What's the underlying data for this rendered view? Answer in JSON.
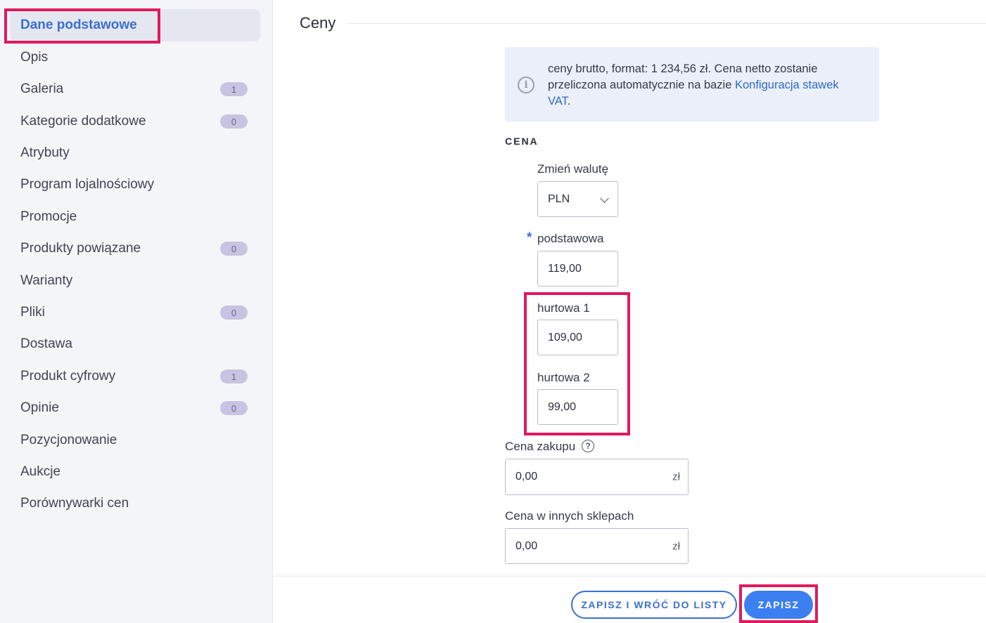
{
  "sidebar": {
    "items": [
      {
        "label": "Dane podstawowe",
        "badge": null
      },
      {
        "label": "Opis",
        "badge": null
      },
      {
        "label": "Galeria",
        "badge": "1"
      },
      {
        "label": "Kategorie dodatkowe",
        "badge": "0"
      },
      {
        "label": "Atrybuty",
        "badge": null
      },
      {
        "label": "Program lojalnościowy",
        "badge": null
      },
      {
        "label": "Promocje",
        "badge": null
      },
      {
        "label": "Produkty powiązane",
        "badge": "0"
      },
      {
        "label": "Warianty",
        "badge": null
      },
      {
        "label": "Pliki",
        "badge": "0"
      },
      {
        "label": "Dostawa",
        "badge": null
      },
      {
        "label": "Produkt cyfrowy",
        "badge": "1"
      },
      {
        "label": "Opinie",
        "badge": "0"
      },
      {
        "label": "Pozycjonowanie",
        "badge": null
      },
      {
        "label": "Aukcje",
        "badge": null
      },
      {
        "label": "Porównywarki cen",
        "badge": null
      }
    ]
  },
  "main": {
    "section_title": "Ceny",
    "info": {
      "text_line1": "ceny brutto, format: 1 234,56 zł. Cena netto zostanie",
      "text_line2_prefix": "przeliczona automatycznie na bazie ",
      "link_part1": "Konfiguracja stawek",
      "link_part2": "VAT",
      "text_suffix": "."
    },
    "cena_heading": "CENA",
    "currency": {
      "label": "Zmień walutę",
      "value": "PLN"
    },
    "podstawowa": {
      "label": "podstawowa",
      "value": "119,00"
    },
    "hurtowa1": {
      "label": "hurtowa 1",
      "value": "109,00"
    },
    "hurtowa2": {
      "label": "hurtowa 2",
      "value": "99,00"
    },
    "cena_zakupu": {
      "label": "Cena zakupu",
      "value": "0,00",
      "unit": "zł"
    },
    "cena_inne": {
      "label": "Cena w innych sklepach",
      "value": "0,00",
      "unit": "zł"
    }
  },
  "footer": {
    "save_back_label": "ZAPISZ I WRÓĆ DO LISTY",
    "save_label": "ZAPISZ"
  },
  "colors": {
    "accent": "#3b6fd1",
    "highlight": "#e0195f",
    "badge": "#c9c3e2"
  }
}
